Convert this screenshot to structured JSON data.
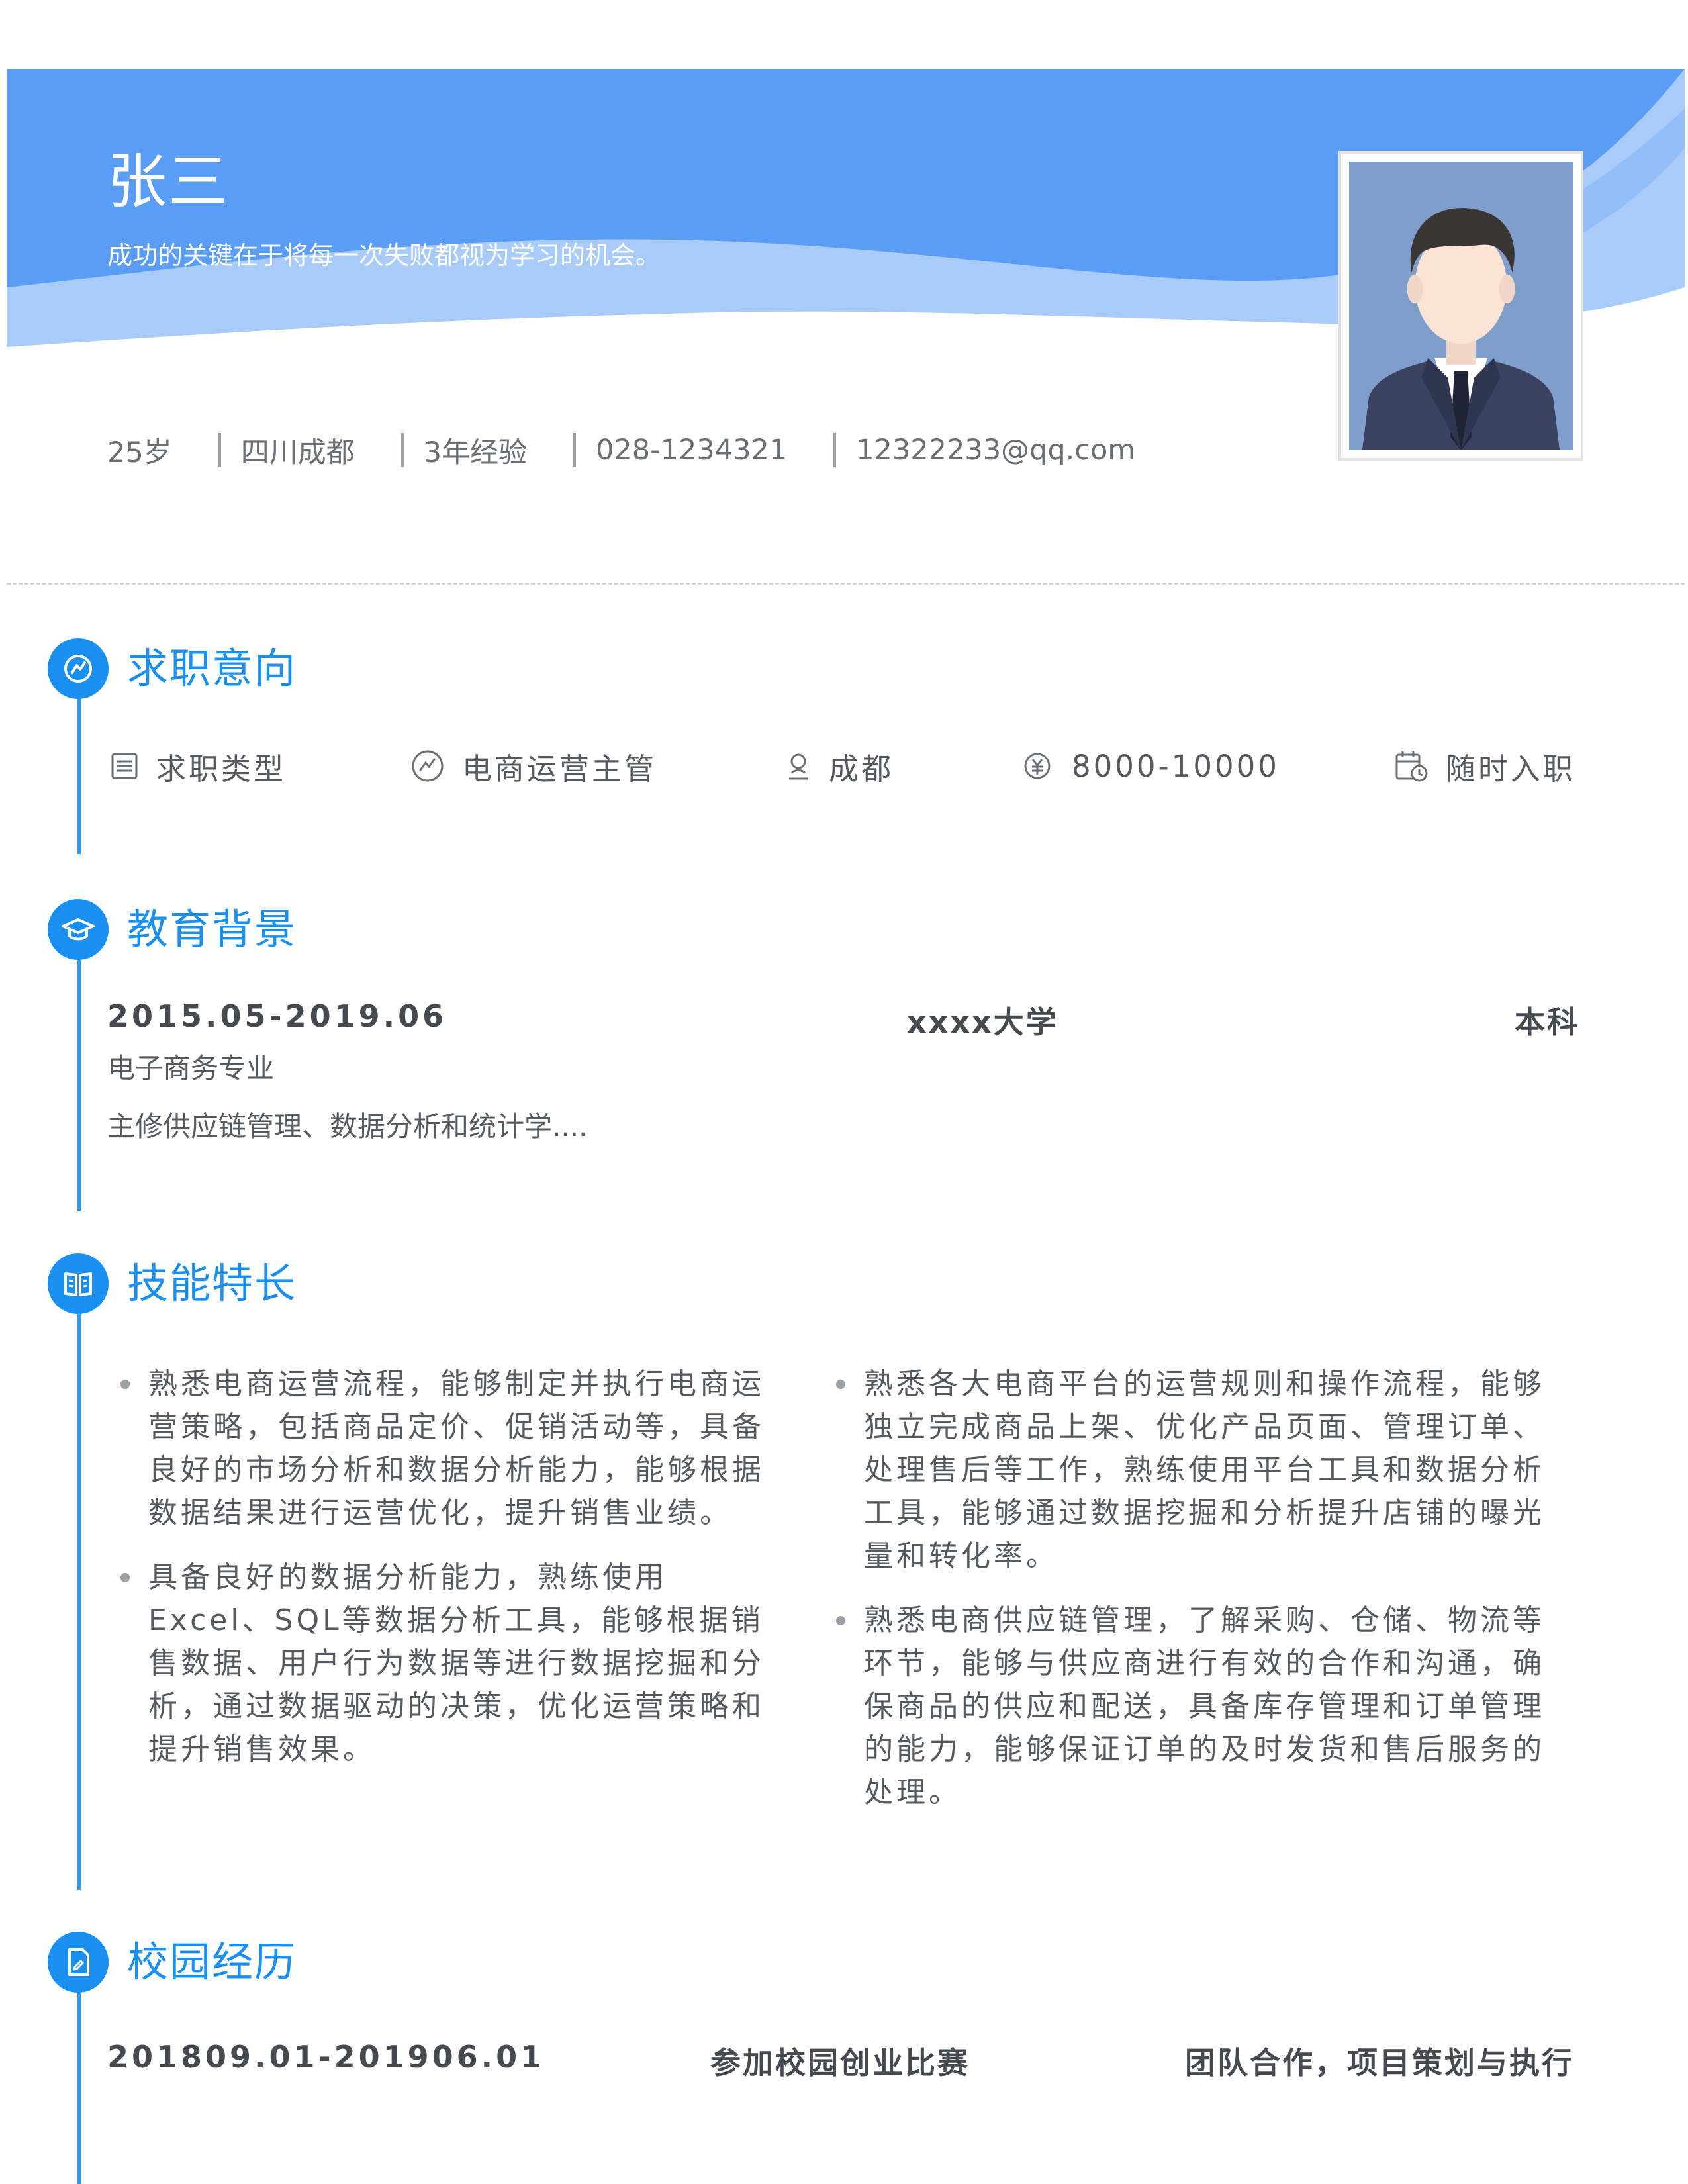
{
  "header": {
    "name": "张三",
    "motto": "成功的关键在于将每一次失败都视为学习的机会。",
    "colors": {
      "banner": "#5b9cf4",
      "banner_light": "#a6c8f8",
      "accent": "#1b8ff0"
    }
  },
  "info": {
    "age": "25岁",
    "location": "四川成都",
    "experience": "3年经验",
    "phone": "028-1234321",
    "email": "12322233@qq.com"
  },
  "job_intention": {
    "title": "求职意向",
    "items": [
      {
        "icon": "list-icon",
        "label": "求职类型"
      },
      {
        "icon": "position-icon",
        "label": "电商运营主管"
      },
      {
        "icon": "location-icon",
        "label": "成都"
      },
      {
        "icon": "salary-icon",
        "label": "8000-10000"
      },
      {
        "icon": "calendar-icon",
        "label": "随时入职"
      }
    ]
  },
  "education": {
    "title": "教育背景",
    "period": "2015.05-2019.06",
    "school": "xxxx大学",
    "degree": "本科",
    "major": "电子商务专业",
    "courses": "主修供应链管理、数据分析和统计学...."
  },
  "skills": {
    "title": "技能特长",
    "left": [
      "熟悉电商运营流程，能够制定并执行电商运营策略，包括商品定价、促销活动等，具备良好的市场分析和数据分析能力，能够根据数据结果进行运营优化，提升销售业绩。",
      "具备良好的数据分析能力，熟练使用Excel、SQL等数据分析工具，能够根据销售数据、用户行为数据等进行数据挖掘和分析，通过数据驱动的决策，优化运营策略和提升销售效果。"
    ],
    "right": [
      "熟悉各大电商平台的运营规则和操作流程，能够独立完成商品上架、优化产品页面、管理订单、处理售后等工作，熟练使用平台工具和数据分析工具，能够通过数据挖掘和分析提升店铺的曝光量和转化率。",
      "熟悉电商供应链管理，了解采购、仓储、物流等环节，能够与供应商进行有效的合作和沟通，确保商品的供应和配送，具备库存管理和订单管理的能力，能够保证订单的及时发货和售后服务的处理。"
    ]
  },
  "campus": {
    "title": "校园经历",
    "period": "201809.01-201906.01",
    "activity": "参加校园创业比赛",
    "role": "团队合作，项目策划与执行"
  }
}
